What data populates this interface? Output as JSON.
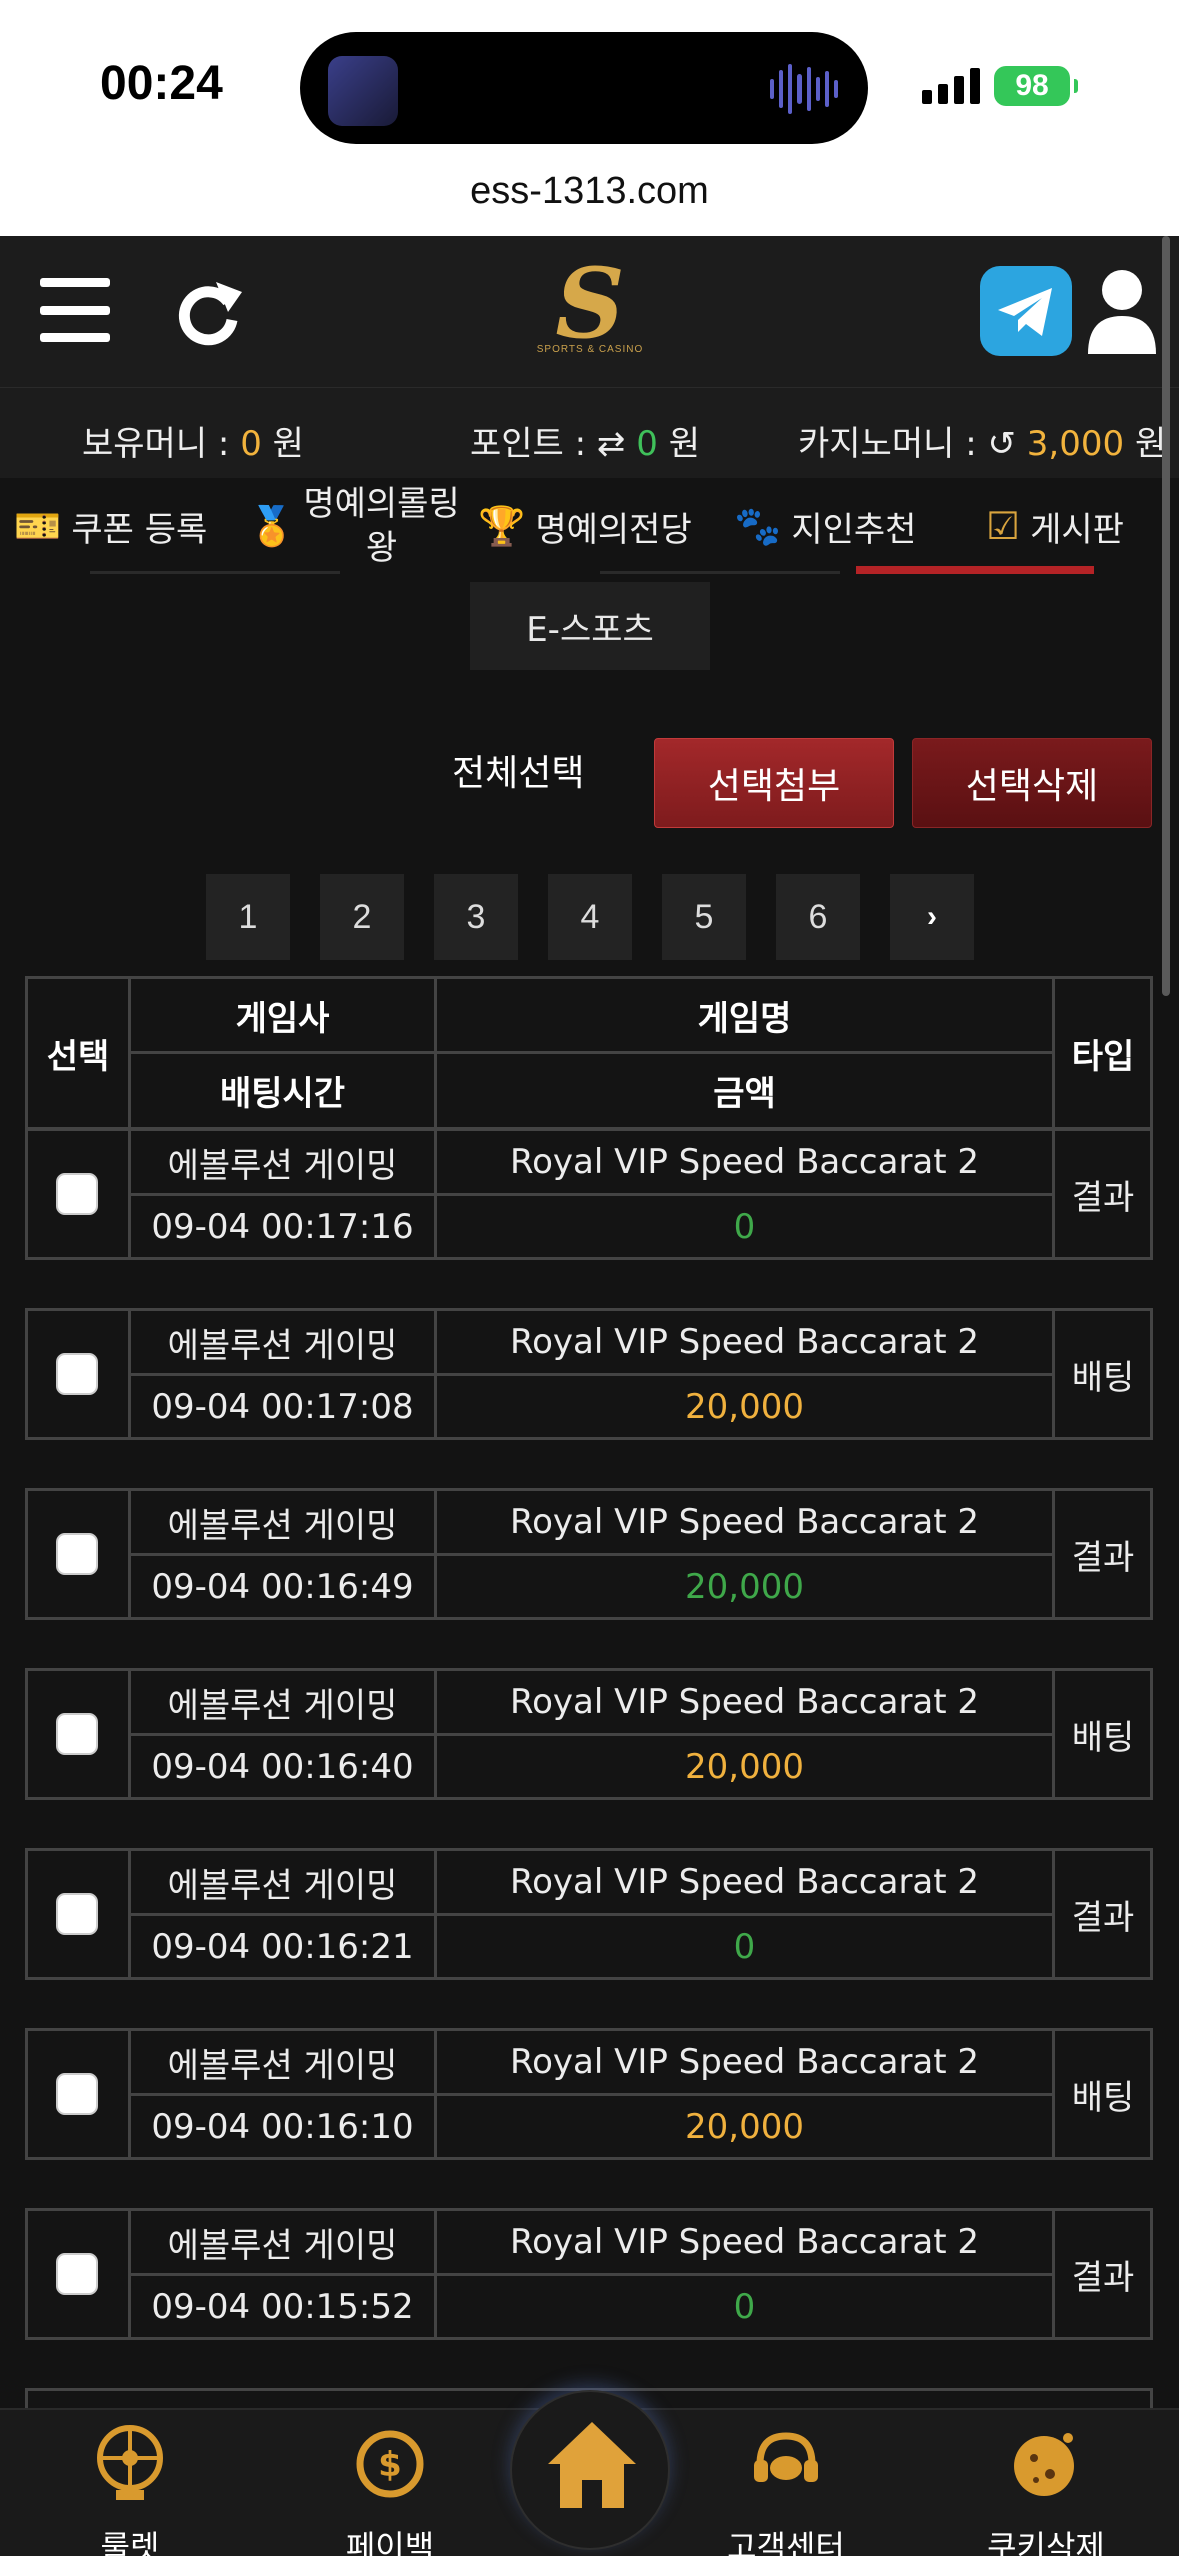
{
  "status_bar": {
    "time": "00:24",
    "battery": "98"
  },
  "browser": {
    "url": "ess-1313.com"
  },
  "header": {
    "logo_letter": "S",
    "logo_sub": "SPORTS & CASINO"
  },
  "money": {
    "holding_label": "보유머니 :",
    "holding_value": "0",
    "point_label": "포인트 :",
    "point_value": "0",
    "casino_label": "카지노머니 :",
    "casino_value": "3,000",
    "unit": "원"
  },
  "menu": {
    "coupon": "쿠폰 등록",
    "rolling_1": "명예의롤링",
    "rolling_2": "왕",
    "hall": "명예의전당",
    "referral": "지인추천",
    "board": "게시판"
  },
  "esports_tab": "E-스포츠",
  "actions": {
    "select_all": "전체선택",
    "attach": "선택첨부",
    "delete": "선택삭제"
  },
  "pagination": {
    "pages": [
      "1",
      "2",
      "3",
      "4",
      "5",
      "6"
    ],
    "next": "›"
  },
  "table_header": {
    "select": "선택",
    "provider": "게임사",
    "game": "게임명",
    "bet_time": "배팅시간",
    "amount": "금액",
    "type": "타입"
  },
  "rows": [
    {
      "provider": "에볼루션 게이밍",
      "game": "Royal VIP Speed Baccarat 2",
      "time": "09-04 00:17:16",
      "amount": "0",
      "amount_color": "#3fa84a",
      "type": "결과"
    },
    {
      "provider": "에볼루션 게이밍",
      "game": "Royal VIP Speed Baccarat 2",
      "time": "09-04 00:17:08",
      "amount": "20,000",
      "amount_color": "#f0b13e",
      "type": "배팅"
    },
    {
      "provider": "에볼루션 게이밍",
      "game": "Royal VIP Speed Baccarat 2",
      "time": "09-04 00:16:49",
      "amount": "20,000",
      "amount_color": "#3fa84a",
      "type": "결과"
    },
    {
      "provider": "에볼루션 게이밍",
      "game": "Royal VIP Speed Baccarat 2",
      "time": "09-04 00:16:40",
      "amount": "20,000",
      "amount_color": "#f0b13e",
      "type": "배팅"
    },
    {
      "provider": "에볼루션 게이밍",
      "game": "Royal VIP Speed Baccarat 2",
      "time": "09-04 00:16:21",
      "amount": "0",
      "amount_color": "#3fa84a",
      "type": "결과"
    },
    {
      "provider": "에볼루션 게이밍",
      "game": "Royal VIP Speed Baccarat 2",
      "time": "09-04 00:16:10",
      "amount": "20,000",
      "amount_color": "#f0b13e",
      "type": "배팅"
    },
    {
      "provider": "에볼루션 게이밍",
      "game": "Royal VIP Speed Baccarat 2",
      "time": "09-04 00:15:52",
      "amount": "0",
      "amount_color": "#3fa84a",
      "type": "결과"
    }
  ],
  "bottom_nav": {
    "roulette": "룰렛",
    "payback": "페이백",
    "support": "고객센터",
    "cookie": "쿠키삭제"
  }
}
